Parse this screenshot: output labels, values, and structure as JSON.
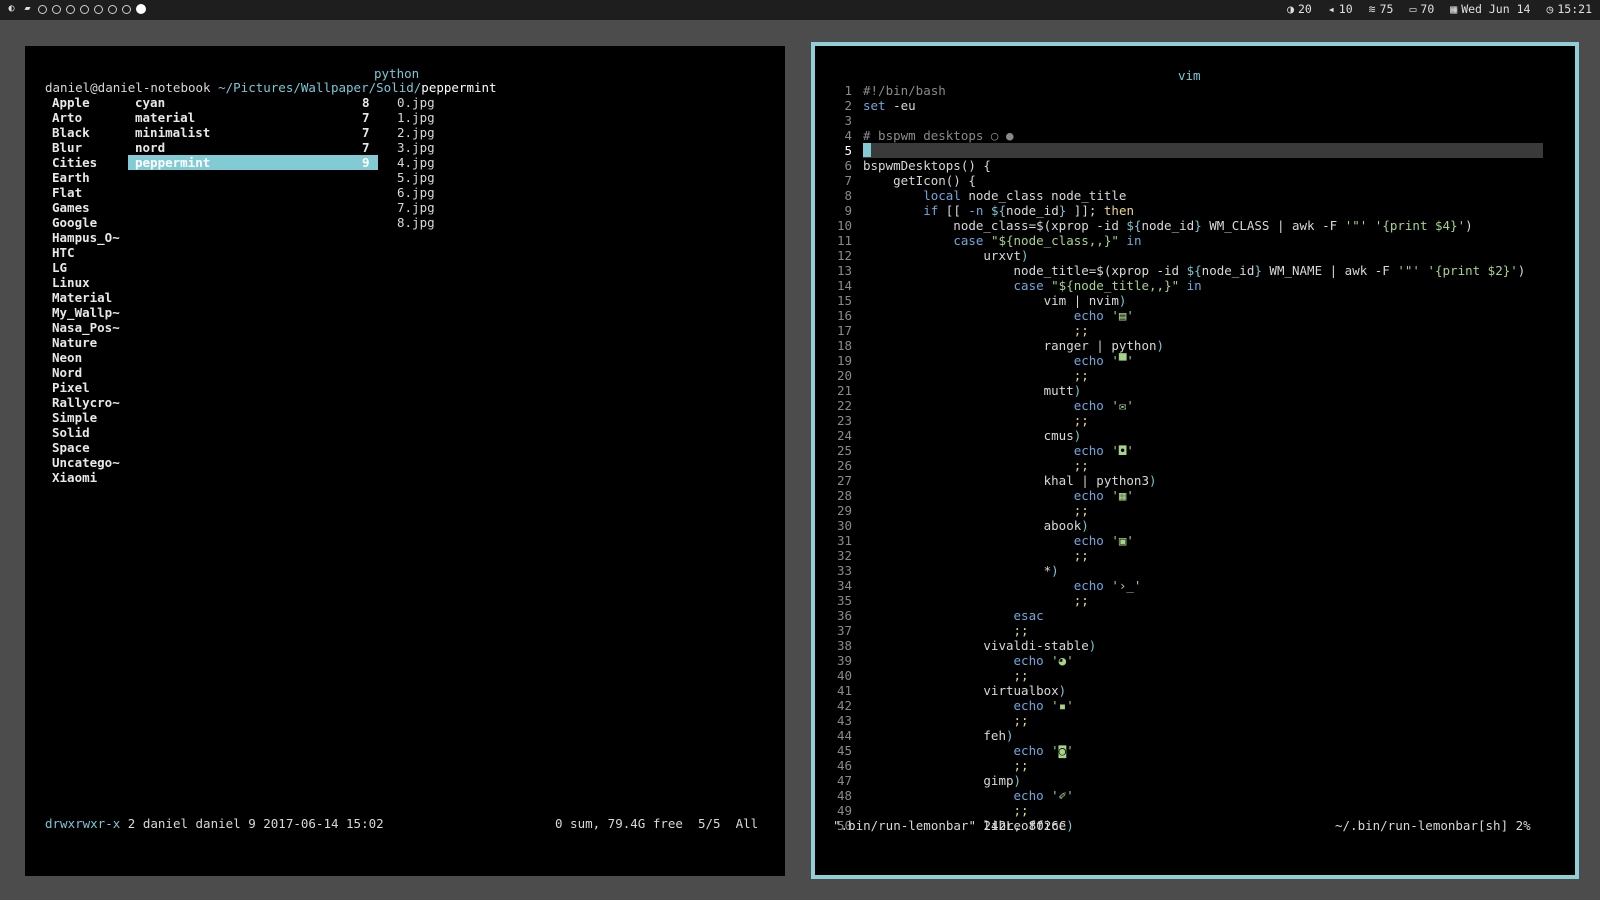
{
  "bar": {
    "workspace_count": 8,
    "active_workspace": 8,
    "icons": [
      "theme-icon",
      "folder-icon"
    ],
    "status": [
      {
        "icon": "brightness-icon",
        "glyph": "◑",
        "value": "20"
      },
      {
        "icon": "volume-icon",
        "glyph": "◂",
        "value": "10"
      },
      {
        "icon": "wifi-icon",
        "glyph": "≋",
        "value": "75"
      },
      {
        "icon": "battery-icon",
        "glyph": "▭",
        "value": "70"
      },
      {
        "icon": "calendar-icon",
        "glyph": "▦",
        "value": "Wed Jun 14"
      },
      {
        "icon": "clock-icon",
        "glyph": "◷",
        "value": "15:21"
      }
    ]
  },
  "ranger": {
    "title": "python",
    "path_prefix": "daniel@daniel-notebook ",
    "path_dir": "~/Pictures/Wallpaper/Solid/",
    "path_current": "peppermint",
    "parent_dirs": [
      "Apple",
      "Arto",
      "Black",
      "Blur",
      "Cities",
      "Earth",
      "Flat",
      "Games",
      "Google",
      "Hampus_O~",
      "HTC",
      "LG",
      "Linux",
      "Material",
      "My_Wallp~",
      "Nasa_Pos~",
      "Nature",
      "Neon",
      "Nord",
      "Pixel",
      "Rallycro~",
      "Simple",
      "Solid",
      "Space",
      "Uncatego~",
      "Xiaomi"
    ],
    "current_dirs": [
      {
        "name": "cyan",
        "count": "8"
      },
      {
        "name": "material",
        "count": "7"
      },
      {
        "name": "minimalist",
        "count": "7"
      },
      {
        "name": "nord",
        "count": "7"
      },
      {
        "name": "peppermint",
        "count": "9"
      }
    ],
    "selected_index": 4,
    "files": [
      "0.jpg",
      "1.jpg",
      "2.jpg",
      "3.jpg",
      "4.jpg",
      "5.jpg",
      "6.jpg",
      "7.jpg",
      "8.jpg"
    ],
    "status_perms": "drwxrwxr-x",
    "status_info": " 2 daniel daniel 9 2017-06-14 15:02",
    "status_right": "0 sum, 79.4G free  5/5  All"
  },
  "vim": {
    "title": "vim",
    "current_line": "5",
    "status_left": "\".bin/run-lemonbar\" 242L, 8026C",
    "status_right": "~/.bin/run-lemonbar[sh] 2%",
    "lines": [
      [
        {
          "t": "#!/bin/bash",
          "c": "grey"
        }
      ],
      [
        {
          "t": "set",
          "c": "blue"
        },
        {
          "t": " -eu"
        }
      ],
      [],
      [
        {
          "t": "# bspwm desktops ○ ●",
          "c": "grey"
        }
      ],
      [],
      [
        {
          "t": "bspwmDesktops() {"
        }
      ],
      [
        {
          "t": "    getIcon() {"
        }
      ],
      [
        {
          "t": "        "
        },
        {
          "t": "local",
          "c": "blue"
        },
        {
          "t": " node_class node_title"
        }
      ],
      [
        {
          "t": "        "
        },
        {
          "t": "if",
          "c": "blue"
        },
        {
          "t": " [[ "
        },
        {
          "t": "-n",
          "c": "blue"
        },
        {
          "t": " "
        },
        {
          "t": "${",
          "c": "cyan"
        },
        {
          "t": "node_id"
        },
        {
          "t": "}",
          "c": "cyan"
        },
        {
          "t": " ]]; "
        },
        {
          "t": "then",
          "c": "yellow"
        }
      ],
      [
        {
          "t": "            node_class=$(xprop -id "
        },
        {
          "t": "${",
          "c": "cyan"
        },
        {
          "t": "node_id"
        },
        {
          "t": "}",
          "c": "cyan"
        },
        {
          "t": " WM_CLASS | awk -F "
        },
        {
          "t": "'\"'",
          "c": "green"
        },
        {
          "t": " "
        },
        {
          "t": "'{print $4}'",
          "c": "green"
        },
        {
          "t": ")"
        }
      ],
      [
        {
          "t": "            "
        },
        {
          "t": "case",
          "c": "blue"
        },
        {
          "t": " "
        },
        {
          "t": "\"${node_class,,}\"",
          "c": "green"
        },
        {
          "t": " "
        },
        {
          "t": "in",
          "c": "blue"
        }
      ],
      [
        {
          "t": "                urxvt"
        },
        {
          "t": ")",
          "c": "cyan"
        }
      ],
      [
        {
          "t": "                    node_title=$(xprop -id "
        },
        {
          "t": "${",
          "c": "cyan"
        },
        {
          "t": "node_id"
        },
        {
          "t": "}",
          "c": "cyan"
        },
        {
          "t": " WM_NAME | awk -F "
        },
        {
          "t": "'\"'",
          "c": "green"
        },
        {
          "t": " "
        },
        {
          "t": "'{print $2}'",
          "c": "green"
        },
        {
          "t": ")"
        }
      ],
      [
        {
          "t": "                    "
        },
        {
          "t": "case",
          "c": "blue"
        },
        {
          "t": " "
        },
        {
          "t": "\"${node_title,,}\"",
          "c": "green"
        },
        {
          "t": " "
        },
        {
          "t": "in",
          "c": "blue"
        }
      ],
      [
        {
          "t": "                        vim | nvim"
        },
        {
          "t": ")",
          "c": "cyan"
        }
      ],
      [
        {
          "t": "                            "
        },
        {
          "t": "echo",
          "c": "blue"
        },
        {
          "t": " "
        },
        {
          "t": "'▤'",
          "c": "green"
        }
      ],
      [
        {
          "t": "                            "
        },
        {
          "t": ";;",
          "c": "yellow"
        }
      ],
      [
        {
          "t": "                        ranger | python"
        },
        {
          "t": ")",
          "c": "cyan"
        }
      ],
      [
        {
          "t": "                            "
        },
        {
          "t": "echo",
          "c": "blue"
        },
        {
          "t": " "
        },
        {
          "t": "'▀'",
          "c": "green"
        }
      ],
      [
        {
          "t": "                            "
        },
        {
          "t": ";;",
          "c": "yellow"
        }
      ],
      [
        {
          "t": "                        mutt"
        },
        {
          "t": ")",
          "c": "cyan"
        }
      ],
      [
        {
          "t": "                            "
        },
        {
          "t": "echo",
          "c": "blue"
        },
        {
          "t": " "
        },
        {
          "t": "'✉'",
          "c": "green"
        }
      ],
      [
        {
          "t": "                            "
        },
        {
          "t": ";;",
          "c": "yellow"
        }
      ],
      [
        {
          "t": "                        cmus"
        },
        {
          "t": ")",
          "c": "cyan"
        }
      ],
      [
        {
          "t": "                            "
        },
        {
          "t": "echo",
          "c": "blue"
        },
        {
          "t": " "
        },
        {
          "t": "'◘'",
          "c": "green"
        }
      ],
      [
        {
          "t": "                            "
        },
        {
          "t": ";;",
          "c": "yellow"
        }
      ],
      [
        {
          "t": "                        khal | python3"
        },
        {
          "t": ")",
          "c": "cyan"
        }
      ],
      [
        {
          "t": "                            "
        },
        {
          "t": "echo",
          "c": "blue"
        },
        {
          "t": " "
        },
        {
          "t": "'▦'",
          "c": "green"
        }
      ],
      [
        {
          "t": "                            "
        },
        {
          "t": ";;",
          "c": "yellow"
        }
      ],
      [
        {
          "t": "                        abook"
        },
        {
          "t": ")",
          "c": "cyan"
        }
      ],
      [
        {
          "t": "                            "
        },
        {
          "t": "echo",
          "c": "blue"
        },
        {
          "t": " "
        },
        {
          "t": "'▣'",
          "c": "green"
        }
      ],
      [
        {
          "t": "                            "
        },
        {
          "t": ";;",
          "c": "yellow"
        }
      ],
      [
        {
          "t": "                        *"
        },
        {
          "t": ")",
          "c": "cyan"
        }
      ],
      [
        {
          "t": "                            "
        },
        {
          "t": "echo",
          "c": "blue"
        },
        {
          "t": " "
        },
        {
          "t": "'›_'",
          "c": "green"
        }
      ],
      [
        {
          "t": "                            "
        },
        {
          "t": ";;",
          "c": "yellow"
        }
      ],
      [
        {
          "t": "                    "
        },
        {
          "t": "esac",
          "c": "blue"
        }
      ],
      [
        {
          "t": "                    "
        },
        {
          "t": ";;",
          "c": "yellow"
        }
      ],
      [
        {
          "t": "                vivaldi-stable"
        },
        {
          "t": ")",
          "c": "cyan"
        }
      ],
      [
        {
          "t": "                    "
        },
        {
          "t": "echo",
          "c": "blue"
        },
        {
          "t": " "
        },
        {
          "t": "'◕'",
          "c": "green"
        }
      ],
      [
        {
          "t": "                    "
        },
        {
          "t": ";;",
          "c": "yellow"
        }
      ],
      [
        {
          "t": "                virtualbox"
        },
        {
          "t": ")",
          "c": "cyan"
        }
      ],
      [
        {
          "t": "                    "
        },
        {
          "t": "echo",
          "c": "blue"
        },
        {
          "t": " "
        },
        {
          "t": "'▪'",
          "c": "green"
        }
      ],
      [
        {
          "t": "                    "
        },
        {
          "t": ";;",
          "c": "yellow"
        }
      ],
      [
        {
          "t": "                feh"
        },
        {
          "t": ")",
          "c": "cyan"
        }
      ],
      [
        {
          "t": "                    "
        },
        {
          "t": "echo",
          "c": "blue"
        },
        {
          "t": " "
        },
        {
          "t": "'◙'",
          "c": "green"
        }
      ],
      [
        {
          "t": "                    "
        },
        {
          "t": ";;",
          "c": "yellow"
        }
      ],
      [
        {
          "t": "                gimp"
        },
        {
          "t": ")",
          "c": "cyan"
        }
      ],
      [
        {
          "t": "                    "
        },
        {
          "t": "echo",
          "c": "blue"
        },
        {
          "t": " "
        },
        {
          "t": "'✐'",
          "c": "green"
        }
      ],
      [
        {
          "t": "                    "
        },
        {
          "t": ";;",
          "c": "yellow"
        }
      ],
      [
        {
          "t": "                libreoffice"
        },
        {
          "t": ")",
          "c": "cyan"
        }
      ]
    ]
  }
}
